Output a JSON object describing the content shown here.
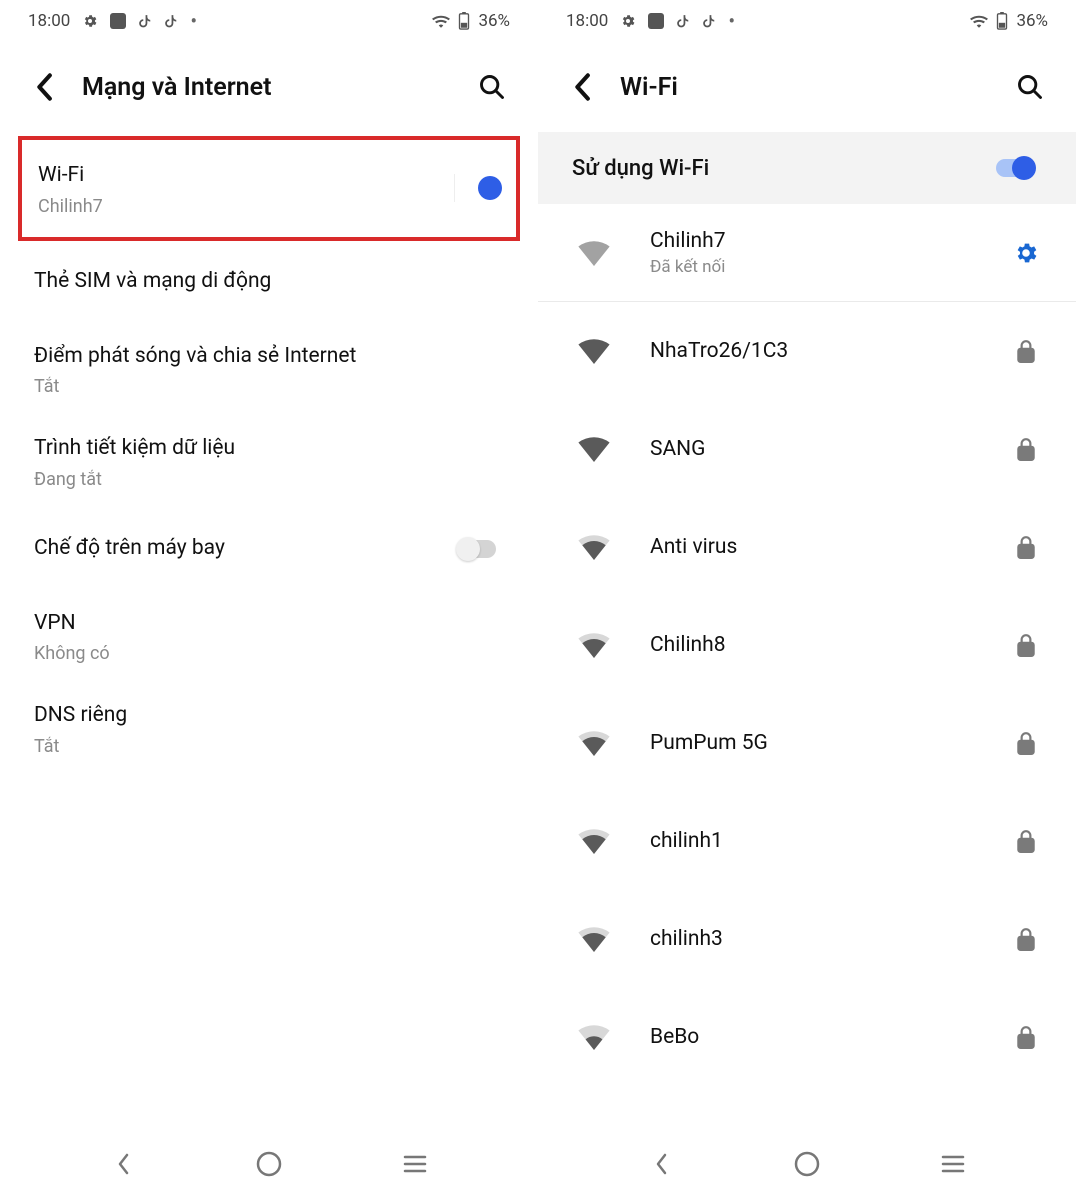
{
  "status": {
    "time": "18:00",
    "battery": "36%"
  },
  "left": {
    "title": "Mạng và Internet",
    "wifi": {
      "title": "Wi-Fi",
      "sub": "Chilinh7"
    },
    "sim": {
      "title": "Thẻ SIM và mạng di động"
    },
    "hotspot": {
      "title": "Điểm phát sóng và chia sẻ Internet",
      "sub": "Tắt"
    },
    "datasaver": {
      "title": "Trình tiết kiệm dữ liệu",
      "sub": "Đang tắt"
    },
    "airplane": {
      "title": "Chế độ trên máy bay"
    },
    "vpn": {
      "title": "VPN",
      "sub": "Không có"
    },
    "dns": {
      "title": "DNS riêng",
      "sub": "Tắt"
    }
  },
  "right": {
    "title": "Wi-Fi",
    "use_wifi": "Sử dụng Wi-Fi",
    "connected": {
      "name": "Chilinh7",
      "status": "Đã kết nối"
    },
    "networks": [
      {
        "name": "NhaTro26/1C3",
        "strength": "full"
      },
      {
        "name": "SANG",
        "strength": "full"
      },
      {
        "name": "Anti virus",
        "strength": "high"
      },
      {
        "name": "Chilinh8",
        "strength": "high"
      },
      {
        "name": "PumPum 5G",
        "strength": "high"
      },
      {
        "name": "chilinh1",
        "strength": "high"
      },
      {
        "name": "chilinh3",
        "strength": "high"
      },
      {
        "name": "BeBo",
        "strength": "med"
      }
    ]
  }
}
